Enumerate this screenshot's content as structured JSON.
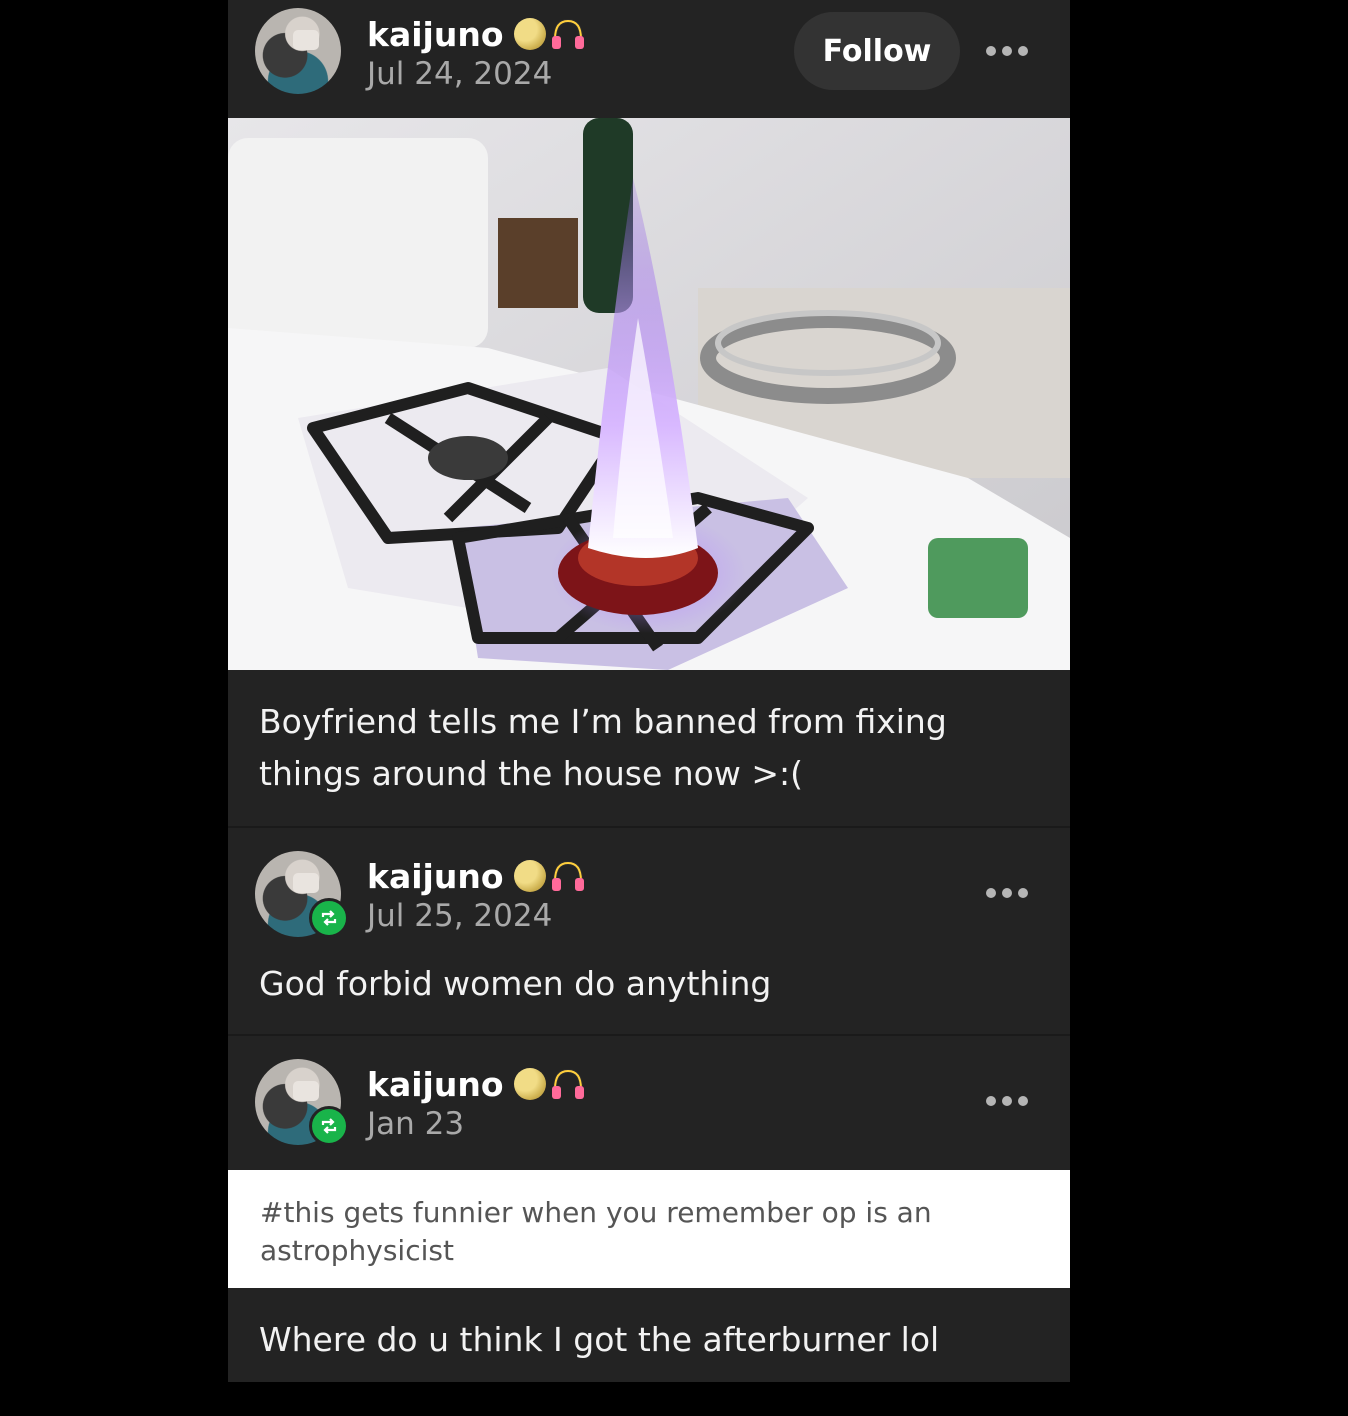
{
  "post": {
    "author": "kaijuno",
    "date": "Jul 24, 2024",
    "follow_label": "Follow",
    "image_alt": "purple flame rising from gas stove burner",
    "caption": "Boyfriend tells me I’m banned from fixing things around the house now >:("
  },
  "reblogs": [
    {
      "author": "kaijuno",
      "date": "Jul 25, 2024",
      "text": "God forbid women do anything"
    },
    {
      "author": "kaijuno",
      "date": "Jan 23",
      "tags": "#this gets funnier when you remember op is an astrophysicist",
      "text": "Where do u think I got the afterburner lol"
    }
  ],
  "icons": {
    "badge": "moon-icon",
    "badge2": "headphones-icon",
    "reblog": "reblog-icon",
    "more": "more-options-icon"
  },
  "colors": {
    "background": "#232323",
    "reblog_badge": "#19b44a",
    "date": "#a9a9a9"
  }
}
